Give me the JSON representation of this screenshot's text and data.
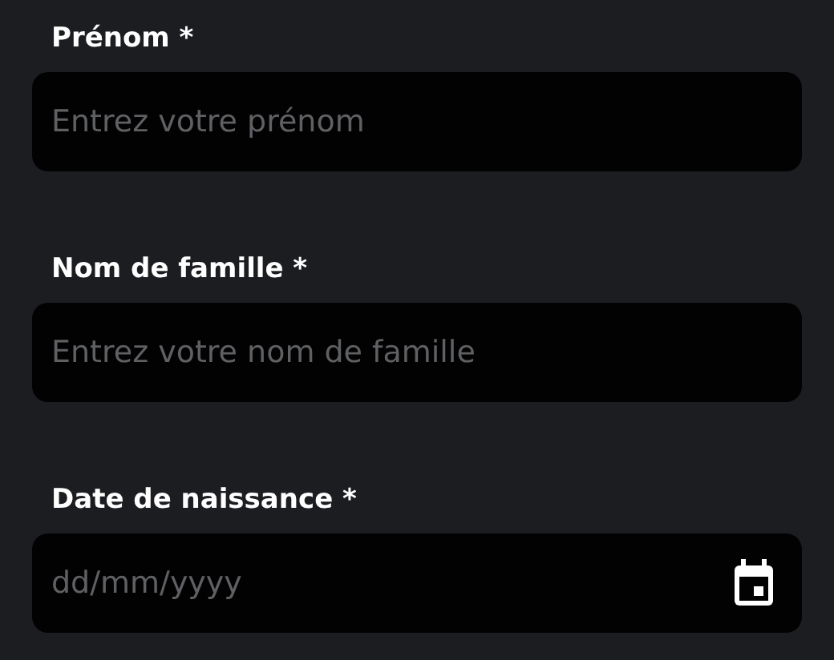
{
  "fields": [
    {
      "kind": "text",
      "label": "Prénom *",
      "placeholder": "Entrez votre prénom"
    },
    {
      "kind": "text",
      "label": "Nom de famille *",
      "placeholder": "Entrez votre nom de famille"
    },
    {
      "kind": "date",
      "label": "Date de naissance *",
      "placeholder": "dd/mm/yyyy"
    }
  ]
}
